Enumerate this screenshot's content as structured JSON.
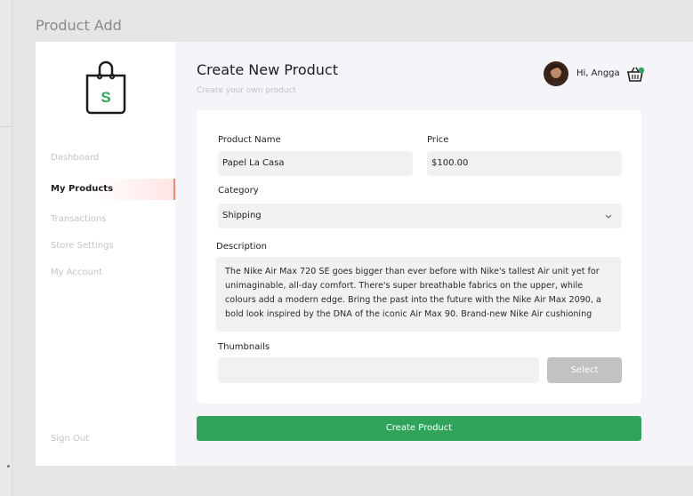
{
  "page": {
    "header": "Product Add"
  },
  "sidebar": {
    "items": [
      {
        "label": "Dashboard"
      },
      {
        "label": "My Products",
        "active": true
      },
      {
        "label": "Transactions"
      },
      {
        "label": "Store Settings"
      },
      {
        "label": "My Account"
      }
    ],
    "sign_out": "Sign Out"
  },
  "header": {
    "title": "Create New Product",
    "subtitle": "Create your own product",
    "greeting": "Hi, Angga"
  },
  "form": {
    "product_name": {
      "label": "Product Name",
      "value": "Papel La Casa"
    },
    "price": {
      "label": "Price",
      "value": "$100.00"
    },
    "category": {
      "label": "Category",
      "value": "Shipping"
    },
    "description": {
      "label": "Description",
      "value": "The Nike Air Max 720 SE goes bigger than ever before with Nike's tallest Air unit yet for unimaginable, all-day comfort. There's super breathable fabrics on the upper, while colours add a modern edge. Bring the past into the future with the Nike Air Max 2090, a bold look inspired by the DNA of the iconic Air Max 90. Brand-new Nike Air cushioning"
    },
    "thumbnails": {
      "label": "Thumbnails",
      "value": "",
      "select_label": "Select"
    },
    "submit_label": "Create Product"
  },
  "icons": {
    "logo": "shopping-bag-icon",
    "logo_letter": "S",
    "cart": "cart-icon",
    "cart_badge": "green-dot",
    "category_dropdown": "chevron-down-icon"
  },
  "colors": {
    "accent_green": "#30a45a",
    "active_nav_highlight": "#f7837a",
    "disabled_button": "#c2c2c2",
    "background": "#f4f4f9"
  }
}
